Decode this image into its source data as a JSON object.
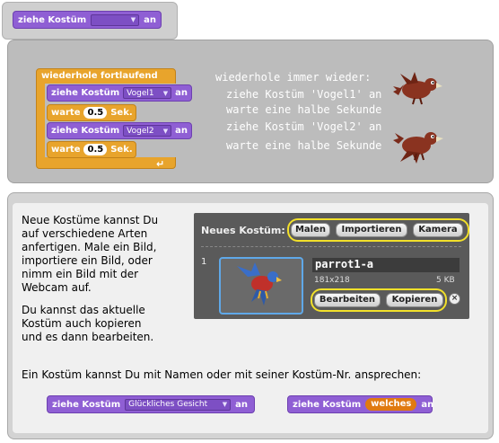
{
  "top_block": {
    "label": "ziehe Kostüm",
    "dropdown_value": "",
    "suffix": "an"
  },
  "loop_example": {
    "forever_label": "wiederhole fortlaufend",
    "rows": [
      {
        "label": "ziehe Kostüm",
        "dropdown_value": "Vogel1",
        "suffix": "an"
      },
      {
        "label": "warte",
        "value": "0.5",
        "suffix": "Sek."
      },
      {
        "label": "ziehe Kostüm",
        "dropdown_value": "Vogel2",
        "suffix": "an"
      },
      {
        "label": "warte",
        "value": "0.5",
        "suffix": "Sek."
      }
    ],
    "explanation": [
      "wiederhole immer wieder:",
      "ziehe Kostüm 'Vogel1' an",
      "warte eine halbe Sekunde",
      "ziehe Kostüm 'Vogel2' an",
      "warte eine halbe Sekunde"
    ]
  },
  "new_costume_text": [
    "Neue Kostüme kannst Du",
    "auf  verschiedene Arten",
    "anfertigen. Male ein Bild,",
    "importiere ein Bild, oder",
    "nimm ein Bild mit der",
    "Webcam auf."
  ],
  "copy_text": [
    "Du kannst das aktuelle",
    "Kostüm auch kopieren",
    "und es dann bearbeiten."
  ],
  "costume_panel": {
    "header": "Neues Kostüm:",
    "buttons": [
      "Malen",
      "Importieren",
      "Kamera"
    ],
    "item_number": "1",
    "costume_name": "parrot1-a",
    "dimensions": "181x218",
    "size": "5 KB",
    "edit_label": "Bearbeiten",
    "copy_label": "Kopieren",
    "delete_icon": "close-icon"
  },
  "address_text": "Ein Kostüm kannst Du mit Namen oder mit seiner Kostüm-Nr. ansprechen:",
  "bottom_blocks": [
    {
      "label": "ziehe Kostüm",
      "dropdown_value": "Glückliches Gesicht",
      "suffix": "an"
    },
    {
      "label": "ziehe Kostüm",
      "reporter_value": "welches",
      "suffix": "an"
    }
  ],
  "colors": {
    "looks_block": "#8f5fd4",
    "control_block": "#e8a42c",
    "highlight": "#f2e02a",
    "reporter": "#e07a10"
  }
}
